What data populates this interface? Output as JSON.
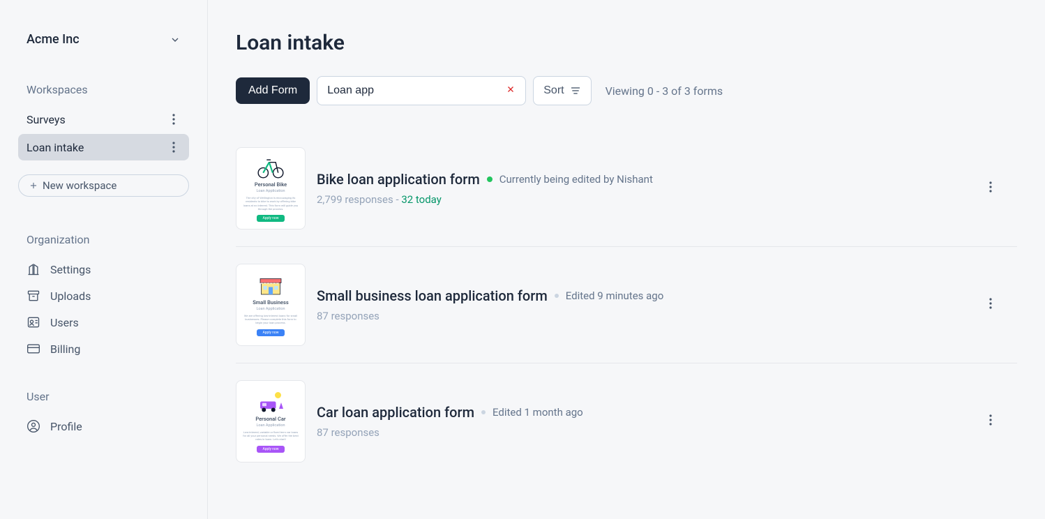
{
  "org": {
    "name": "Acme Inc"
  },
  "sidebar": {
    "workspaces_label": "Workspaces",
    "items": [
      {
        "label": "Surveys"
      },
      {
        "label": "Loan intake"
      }
    ],
    "new_workspace_label": "New workspace",
    "organization_label": "Organization",
    "nav": {
      "settings": "Settings",
      "uploads": "Uploads",
      "users": "Users",
      "billing": "Billing"
    },
    "user_label": "User",
    "profile": "Profile"
  },
  "page": {
    "title": "Loan intake",
    "add_form_label": "Add Form",
    "search_value": "Loan app",
    "sort_label": "Sort",
    "viewing_text": "Viewing 0 - 3 of 3 forms"
  },
  "forms": [
    {
      "title": "Bike loan application form",
      "status_kind": "editing",
      "status_text": "Currently being edited by Nishant",
      "responses_text": "2,799 responses - ",
      "responses_today": "32 today",
      "thumb": {
        "title": "Personal Bike",
        "sub": "Loan Application",
        "btn": "Apply now",
        "accent": "green"
      }
    },
    {
      "title": "Small business loan application form",
      "status_kind": "edited",
      "status_text": "Edited 9 minutes ago",
      "responses_text": "87 responses",
      "responses_today": "",
      "thumb": {
        "title": "Small Business",
        "sub": "Loan Application",
        "btn": "Apply now",
        "accent": "blue"
      }
    },
    {
      "title": "Car loan application form",
      "status_kind": "edited",
      "status_text": "Edited 1 month ago",
      "responses_text": "87 responses",
      "responses_today": "",
      "thumb": {
        "title": "Personal Car",
        "sub": "Loan Application",
        "btn": "Apply now",
        "accent": "purple"
      }
    }
  ]
}
